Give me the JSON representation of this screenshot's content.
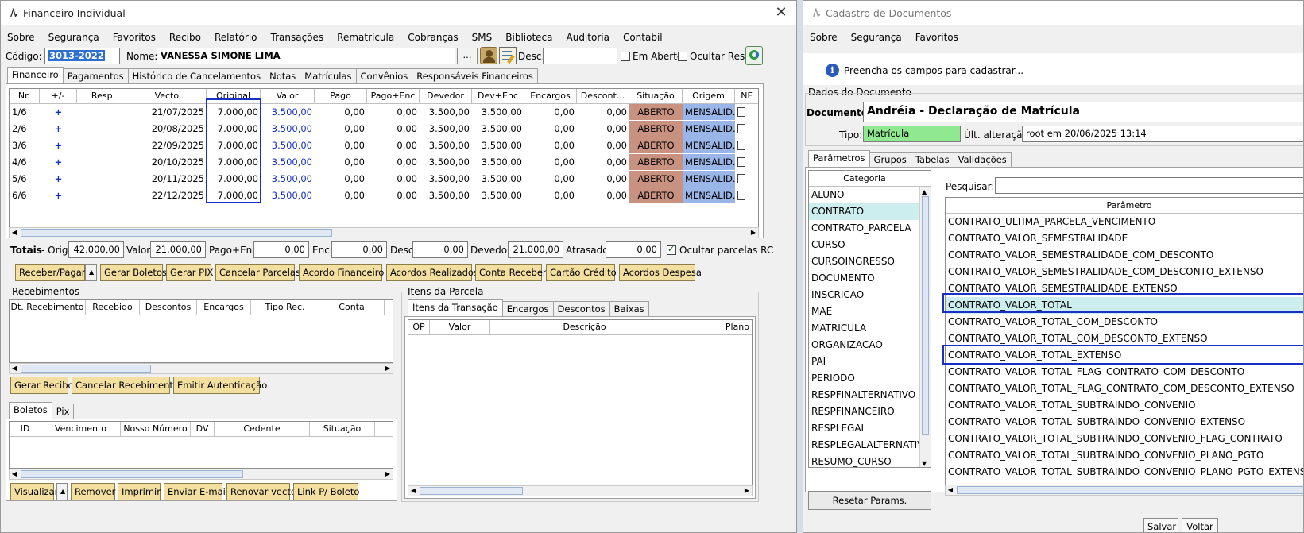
{
  "winA": {
    "title": "Financeiro Individual",
    "logo": "/\\.",
    "menu": [
      "Sobre",
      "Segurança",
      "Favoritos",
      "Recibo",
      "Relatório",
      "Transações",
      "Rematrícula",
      "Cobranças",
      "SMS",
      "Biblioteca",
      "Auditoria",
      "Contabil"
    ],
    "codigo_label": "Código:",
    "codigo_value": "3013-2022",
    "nome_label": "Nome:",
    "nome_value": "VANESSA SIMONE LIMA",
    "ellipsis": "...",
    "desc_label": "Desc.:",
    "em_aberto": "Em Aberto",
    "ocultar_resp": "Ocultar Resp.",
    "tabs": [
      "Financeiro",
      "Pagamentos",
      "Histórico de Cancelamentos",
      "Notas",
      "Matrículas",
      "Convênios",
      "Responsáveis Financeiros"
    ],
    "grid_headers": [
      "Nr.",
      "+/-",
      "Resp.",
      "Vecto.",
      "Original",
      "Valor",
      "Pago",
      "Pago+Enc",
      "Devedor",
      "Dev+Enc",
      "Encargos",
      "Descont...",
      "Situação",
      "Origem",
      "NF"
    ],
    "rows": [
      {
        "nr": "1/6",
        "plus": "+",
        "vecto": "21/07/2025",
        "original": "7.000,00",
        "valor": "3.500,00",
        "pago": "0,00",
        "pagoenc": "0,00",
        "devedor": "3.500,00",
        "devenc": "3.500,00",
        "encargos": "0,00",
        "desc": "0,00",
        "situacao": "ABERTO",
        "origem": "MENSALID..."
      },
      {
        "nr": "2/6",
        "plus": "+",
        "vecto": "20/08/2025",
        "original": "7.000,00",
        "valor": "3.500,00",
        "pago": "0,00",
        "pagoenc": "0,00",
        "devedor": "3.500,00",
        "devenc": "3.500,00",
        "encargos": "0,00",
        "desc": "0,00",
        "situacao": "ABERTO",
        "origem": "MENSALID..."
      },
      {
        "nr": "3/6",
        "plus": "+",
        "vecto": "22/09/2025",
        "original": "7.000,00",
        "valor": "3.500,00",
        "pago": "0,00",
        "pagoenc": "0,00",
        "devedor": "3.500,00",
        "devenc": "3.500,00",
        "encargos": "0,00",
        "desc": "0,00",
        "situacao": "ABERTO",
        "origem": "MENSALID..."
      },
      {
        "nr": "4/6",
        "plus": "+",
        "vecto": "20/10/2025",
        "original": "7.000,00",
        "valor": "3.500,00",
        "pago": "0,00",
        "pagoenc": "0,00",
        "devedor": "3.500,00",
        "devenc": "3.500,00",
        "encargos": "0,00",
        "desc": "0,00",
        "situacao": "ABERTO",
        "origem": "MENSALID..."
      },
      {
        "nr": "5/6",
        "plus": "+",
        "vecto": "20/11/2025",
        "original": "7.000,00",
        "valor": "3.500,00",
        "pago": "0,00",
        "pagoenc": "0,00",
        "devedor": "3.500,00",
        "devenc": "3.500,00",
        "encargos": "0,00",
        "desc": "0,00",
        "situacao": "ABERTO",
        "origem": "MENSALID..."
      },
      {
        "nr": "6/6",
        "plus": "+",
        "vecto": "22/12/2025",
        "original": "7.000,00",
        "valor": "3.500,00",
        "pago": "0,00",
        "pagoenc": "0,00",
        "devedor": "3.500,00",
        "devenc": "3.500,00",
        "encargos": "0,00",
        "desc": "0,00",
        "situacao": "ABERTO",
        "origem": "MENSALID..."
      }
    ],
    "totais": {
      "label": "Totais",
      "orig_label": "- Orig:",
      "orig": "42.000,00",
      "valor_label": "Valor:",
      "valor": "21.000,00",
      "pagoenc_label": "Pago+Enc:",
      "pagoenc": "0,00",
      "enc_label": "Enc:",
      "enc": "0,00",
      "desc_label": "Desc:",
      "desc": "0,00",
      "devedor_label": "Devedor:",
      "devedor": "21.000,00",
      "atrasado_label": "Atrasado:",
      "atrasado": "0,00",
      "ocultar": "Ocultar parcelas RC"
    },
    "actions": [
      "Receber/Pagar",
      "Gerar Boletos",
      "Gerar PIX",
      "Cancelar Parcelas",
      "Acordo Financeiro",
      "Acordos Realizados",
      "Conta Receber",
      "Cartão Crédito",
      "Acordos Despesa"
    ],
    "recebimentos": {
      "title": "Recebimentos",
      "headers": [
        "Dt. Recebimento",
        "Recebido",
        "Descontos",
        "Encargos",
        "Tipo Rec.",
        "Conta"
      ],
      "buttons": [
        "Gerar Recibo",
        "Cancelar Recebimento",
        "Emitir Autenticação"
      ]
    },
    "itens": {
      "title": "Itens da Parcela",
      "tabs": [
        "Itens da Transação",
        "Encargos",
        "Descontos",
        "Baixas"
      ],
      "headers": [
        "OP",
        "Valor",
        "Descrição",
        "Plano"
      ]
    },
    "boletos": {
      "tabs": [
        "Boletos",
        "Pix"
      ],
      "headers": [
        "ID",
        "Vencimento",
        "Nosso Número",
        "DV",
        "Cedente",
        "Situação"
      ],
      "buttons": [
        "Visualizar",
        "Remover",
        "Imprimir",
        "Enviar E-mail",
        "Renovar vecto",
        "Link P/ Boleto"
      ]
    }
  },
  "winB": {
    "title": "Cadastro de Documentos",
    "menu": [
      "Sobre",
      "Segurança",
      "Favoritos"
    ],
    "info": "Preencha os campos para cadastrar...",
    "group_title": "Dados do Documento",
    "documento_label": "Documento:",
    "documento_value": "Andréia - Declaração de Matrícula",
    "tipo_label": "Tipo:",
    "tipo_value": "Matrícula",
    "ult_label": "Últ. alteração:",
    "ult_value": "root em 20/06/2025 13:14",
    "tabs": [
      "Parâmetros",
      "Grupos",
      "Tabelas",
      "Validações"
    ],
    "categoria_header": "Categoria",
    "categorias": [
      "ALUNO",
      "CONTRATO",
      "CONTRATO_PARCELA",
      "CURSO",
      "CURSOINGRESSO",
      "DOCUMENTO",
      "INSCRICAO",
      "MAE",
      "MATRICULA",
      "ORGANIZACAO",
      "PAI",
      "PERIODO",
      "RESPFINALTERNATIVO",
      "RESPFINANCEIRO",
      "RESPLEGAL",
      "RESPLEGALALTERNATIVO",
      "RESUMO_CURSO"
    ],
    "pesquisar_label": "Pesquisar:",
    "parametro_header": "Parâmetro",
    "parametros": [
      "CONTRATO_ULTIMA_PARCELA_VENCIMENTO",
      "CONTRATO_VALOR_SEMESTRALIDADE",
      "CONTRATO_VALOR_SEMESTRALIDADE_COM_DESCONTO",
      "CONTRATO_VALOR_SEMESTRALIDADE_COM_DESCONTO_EXTENSO",
      "CONTRATO_VALOR_SEMESTRALIDADE_EXTENSO",
      "CONTRATO_VALOR_TOTAL",
      "CONTRATO_VALOR_TOTAL_COM_DESCONTO",
      "CONTRATO_VALOR_TOTAL_COM_DESCONTO_EXTENSO",
      "CONTRATO_VALOR_TOTAL_EXTENSO",
      "CONTRATO_VALOR_TOTAL_FLAG_CONTRATO_COM_DESCONTO",
      "CONTRATO_VALOR_TOTAL_FLAG_CONTRATO_COM_DESCONTO_EXTENSO",
      "CONTRATO_VALOR_TOTAL_SUBTRAINDO_CONVENIO",
      "CONTRATO_VALOR_TOTAL_SUBTRAINDO_CONVENIO_EXTENSO",
      "CONTRATO_VALOR_TOTAL_SUBTRAINDO_CONVENIO_FLAG_CONTRATO",
      "CONTRATO_VALOR_TOTAL_SUBTRAINDO_CONVENIO_PLANO_PGTO",
      "CONTRATO_VALOR_TOTAL_SUBTRAINDO_CONVENIO_PLANO_PGTO_EXTENSO"
    ],
    "resetar": "Resetar Params.",
    "salvar": "Salvar",
    "voltar": "Voltar"
  },
  "colors": {
    "highlight_border": "#1a2fc8",
    "situacao_bg": "#c99180",
    "origem_bg": "#9ab5e8",
    "button_bg": "#f3dfa0",
    "tipo_bg": "#90e890",
    "selected_row": "#cdeeee"
  }
}
